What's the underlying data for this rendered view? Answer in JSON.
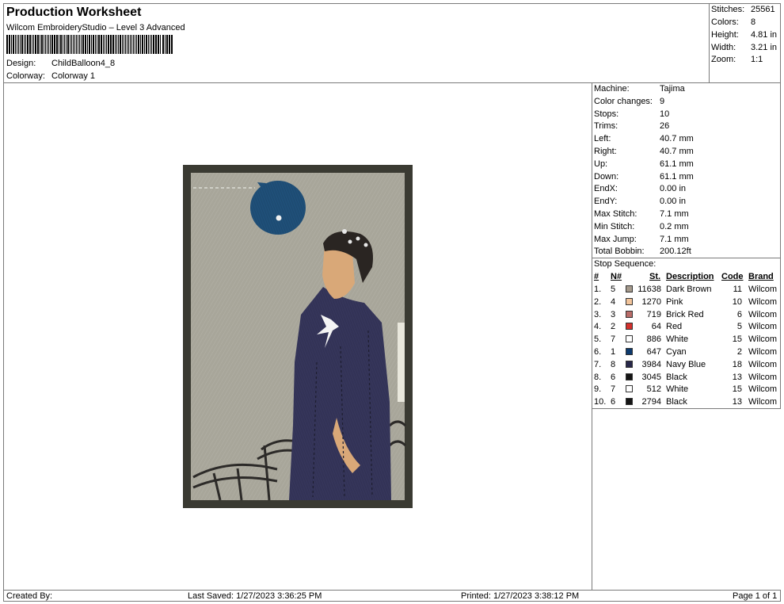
{
  "header": {
    "title": "Production Worksheet",
    "subtitle": "Wilcom EmbroideryStudio – Level 3 Advanced",
    "design_label": "Design:",
    "design_value": "ChildBalloon4_8",
    "colorway_label": "Colorway:",
    "colorway_value": "Colorway 1"
  },
  "summary": [
    {
      "label": "Stitches:",
      "value": "25561"
    },
    {
      "label": "Colors:",
      "value": "8"
    },
    {
      "label": "Height:",
      "value": "4.81 in"
    },
    {
      "label": "Width:",
      "value": "3.21 in"
    },
    {
      "label": "Zoom:",
      "value": "1:1"
    }
  ],
  "machine_info": [
    {
      "label": "Machine:",
      "value": "Tajima"
    },
    {
      "label": "Color changes:",
      "value": "9"
    },
    {
      "label": "Stops:",
      "value": "10"
    },
    {
      "label": "Trims:",
      "value": "26"
    },
    {
      "label": "Left:",
      "value": "40.7 mm"
    },
    {
      "label": "Right:",
      "value": "40.7 mm"
    },
    {
      "label": "Up:",
      "value": "61.1 mm"
    },
    {
      "label": "Down:",
      "value": "61.1 mm"
    },
    {
      "label": "EndX:",
      "value": "0.00 in"
    },
    {
      "label": "EndY:",
      "value": "0.00 in"
    },
    {
      "label": "Max Stitch:",
      "value": "7.1 mm"
    },
    {
      "label": "Min Stitch:",
      "value": "0.2 mm"
    },
    {
      "label": "Max Jump:",
      "value": "7.1 mm"
    },
    {
      "label": "Total Bobbin:",
      "value": "200.12ft"
    }
  ],
  "stop_sequence": {
    "title": "Stop Sequence:",
    "headers": {
      "num": "#",
      "n": "N#",
      "st": "St.",
      "description": "Description",
      "code": "Code",
      "brand": "Brand"
    },
    "rows": [
      {
        "num": "1.",
        "n": "5",
        "color": "#a59a8c",
        "st": "11638",
        "description": "Dark Brown",
        "code": "11",
        "brand": "Wilcom"
      },
      {
        "num": "2.",
        "n": "4",
        "color": "#f2c49b",
        "st": "1270",
        "description": "Pink",
        "code": "10",
        "brand": "Wilcom"
      },
      {
        "num": "3.",
        "n": "3",
        "color": "#b96c68",
        "st": "719",
        "description": "Brick Red",
        "code": "6",
        "brand": "Wilcom"
      },
      {
        "num": "4.",
        "n": "2",
        "color": "#d3302c",
        "st": "64",
        "description": "Red",
        "code": "5",
        "brand": "Wilcom"
      },
      {
        "num": "5.",
        "n": "7",
        "color": "#ffffff",
        "st": "886",
        "description": "White",
        "code": "15",
        "brand": "Wilcom"
      },
      {
        "num": "6.",
        "n": "1",
        "color": "#0d3a6e",
        "st": "647",
        "description": "Cyan",
        "code": "2",
        "brand": "Wilcom"
      },
      {
        "num": "7.",
        "n": "8",
        "color": "#28284a",
        "st": "3984",
        "description": "Navy Blue",
        "code": "18",
        "brand": "Wilcom"
      },
      {
        "num": "8.",
        "n": "6",
        "color": "#151515",
        "st": "3045",
        "description": "Black",
        "code": "13",
        "brand": "Wilcom"
      },
      {
        "num": "9.",
        "n": "7",
        "color": "#ffffff",
        "st": "512",
        "description": "White",
        "code": "15",
        "brand": "Wilcom"
      },
      {
        "num": "10.",
        "n": "6",
        "color": "#151515",
        "st": "2794",
        "description": "Black",
        "code": "13",
        "brand": "Wilcom"
      }
    ]
  },
  "footer": {
    "created_by": "Created By:",
    "last_saved": "Last Saved: 1/27/2023 3:36:25 PM",
    "printed": "Printed: 1/27/2023 3:38:12 PM",
    "page": "Page 1 of 1"
  },
  "preview_colors": {
    "border": "#3a3a32",
    "background": "#a8a69a",
    "balloon": "#1f4f78",
    "robe": "#35355a",
    "skin": "#d9a878",
    "hair": "#2a2522"
  }
}
